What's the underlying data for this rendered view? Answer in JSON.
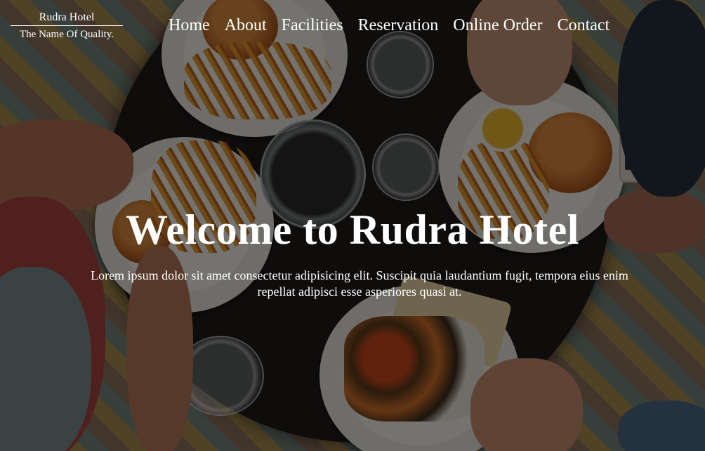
{
  "brand": {
    "name": "Rudra Hotel",
    "tagline": "The Name Of Quality."
  },
  "nav": {
    "items": [
      {
        "label": "Home"
      },
      {
        "label": "About"
      },
      {
        "label": "Facilities"
      },
      {
        "label": "Reservation"
      },
      {
        "label": "Online Order"
      },
      {
        "label": "Contact"
      }
    ]
  },
  "hero": {
    "title": "Welcome to Rudra Hotel",
    "text": "Lorem ipsum dolor sit amet consectetur adipisicing elit. Suscipit quia laudantium fugit, tempora eius enim repellat adipisci esse asperiores quasi at.",
    "background_image": "overhead-restaurant-table-photo"
  },
  "colors": {
    "text": "#ffffff",
    "overlay": "#000000"
  }
}
